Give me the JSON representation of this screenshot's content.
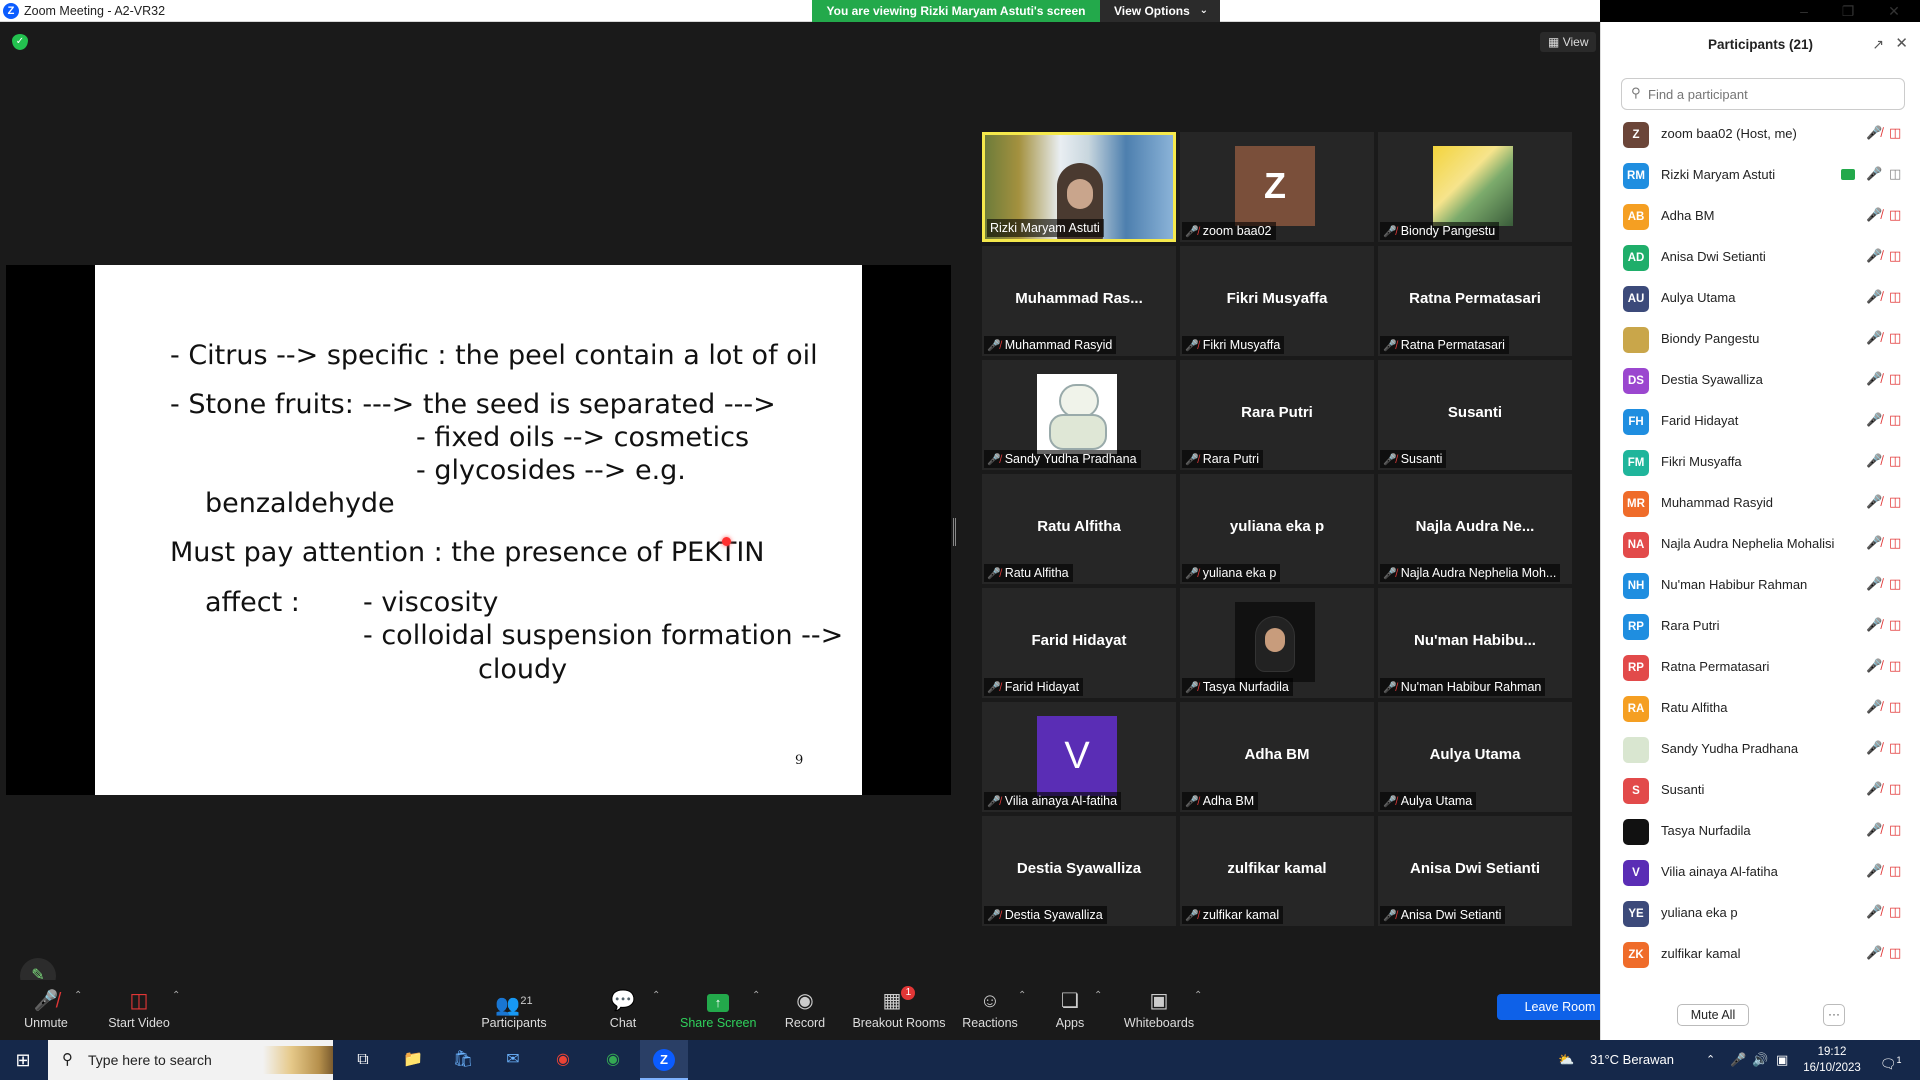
{
  "window": {
    "title": "Zoom Meeting - A2-VR32",
    "share_banner": "You are viewing Rizki Maryam Astuti's screen",
    "view_options": "View Options",
    "view_button": "View"
  },
  "slide": {
    "lines": [
      "-   Citrus --> specific : the peel contain a lot of oil",
      "-   Stone fruits: ---> the seed is separated --->",
      "- fixed oils --> cosmetics",
      "- glycosides --> e.g.",
      "benzaldehyde",
      "Must pay attention : the presence of PEKTIN",
      "affect :",
      "- viscosity",
      "- colloidal suspension formation -->",
      "cloudy"
    ],
    "page_number": "9"
  },
  "gallery": [
    {
      "center_name": "",
      "label": "Rizki Maryam Astuti",
      "muted": false,
      "avatar": "video",
      "active": true
    },
    {
      "center_name": "",
      "label": "zoom baa02",
      "muted": true,
      "avatar": "letter",
      "letter": "Z",
      "active": false
    },
    {
      "center_name": "",
      "label": "Biondy Pangestu",
      "muted": true,
      "avatar": "photo",
      "active": false
    },
    {
      "center_name": "Muhammad  Ras...",
      "label": "Muhammad Rasyid",
      "muted": true,
      "avatar": "none",
      "active": false
    },
    {
      "center_name": "Fikri Musyaffa",
      "label": "Fikri Musyaffa",
      "muted": true,
      "avatar": "none",
      "active": false
    },
    {
      "center_name": "Ratna Permatasari",
      "label": "Ratna Permatasari",
      "muted": true,
      "avatar": "none",
      "active": false
    },
    {
      "center_name": "",
      "label": "Sandy Yudha Pradhana",
      "muted": true,
      "avatar": "bear",
      "active": false
    },
    {
      "center_name": "Rara Putri",
      "label": "Rara Putri",
      "muted": true,
      "avatar": "none",
      "active": false
    },
    {
      "center_name": "Susanti",
      "label": "Susanti",
      "muted": true,
      "avatar": "none",
      "active": false
    },
    {
      "center_name": "Ratu Alfitha",
      "label": "Ratu Alfitha",
      "muted": true,
      "avatar": "none",
      "active": false
    },
    {
      "center_name": "yuliana eka p",
      "label": "yuliana eka p",
      "muted": true,
      "avatar": "none",
      "active": false
    },
    {
      "center_name": "Najla  Audra  Ne...",
      "label": "Najla Audra Nephelia Moh...",
      "muted": true,
      "avatar": "none",
      "active": false
    },
    {
      "center_name": "Farid Hidayat",
      "label": "Farid Hidayat",
      "muted": true,
      "avatar": "none",
      "active": false
    },
    {
      "center_name": "",
      "label": "Tasya Nurfadila",
      "muted": true,
      "avatar": "girl",
      "active": false
    },
    {
      "center_name": "Nu'man  Habibu...",
      "label": "Nu'man Habibur Rahman",
      "muted": true,
      "avatar": "none",
      "active": false
    },
    {
      "center_name": "",
      "label": "Vilia ainaya Al-fatiha",
      "muted": true,
      "avatar": "letter_v",
      "letter": "V",
      "active": false
    },
    {
      "center_name": "Adha BM",
      "label": "Adha BM",
      "muted": true,
      "avatar": "none",
      "active": false
    },
    {
      "center_name": "Aulya Utama",
      "label": "Aulya Utama",
      "muted": true,
      "avatar": "none",
      "active": false
    },
    {
      "center_name": "Destia Syawalliza",
      "label": "Destia Syawalliza",
      "muted": true,
      "avatar": "none",
      "active": false
    },
    {
      "center_name": "zulfikar kamal",
      "label": "zulfikar kamal",
      "muted": true,
      "avatar": "none",
      "active": false
    },
    {
      "center_name": "Anisa Dwi Setianti",
      "label": "Anisa Dwi Setianti",
      "muted": true,
      "avatar": "none",
      "active": false
    }
  ],
  "toolbar": {
    "unmute": "Unmute",
    "start_video": "Start Video",
    "participants": "Participants",
    "participants_count": "21",
    "chat": "Chat",
    "share_screen": "Share Screen",
    "record": "Record",
    "breakout_rooms": "Breakout Rooms",
    "breakout_badge": "1",
    "reactions": "Reactions",
    "apps": "Apps",
    "whiteboards": "Whiteboards",
    "leave_room": "Leave Room"
  },
  "panel": {
    "title": "Participants (21)",
    "search_placeholder": "Find a participant",
    "participants": [
      {
        "initials": "Z",
        "name": "zoom baa02 (Host, me)",
        "color": "#6b4538",
        "sharing": false
      },
      {
        "initials": "RM",
        "name": "Rizki Maryam Astuti",
        "color": "#1f8ee0",
        "sharing": true
      },
      {
        "initials": "AB",
        "name": "Adha BM",
        "color": "#f59f22",
        "sharing": false
      },
      {
        "initials": "AD",
        "name": "Anisa Dwi Setianti",
        "color": "#1fae6a",
        "sharing": false
      },
      {
        "initials": "AU",
        "name": "Aulya Utama",
        "color": "#3c4a7a",
        "sharing": false
      },
      {
        "initials": "",
        "name": "Biondy Pangestu",
        "color": "#c9a64a",
        "sharing": false
      },
      {
        "initials": "DS",
        "name": "Destia Syawalliza",
        "color": "#9b47cf",
        "sharing": false
      },
      {
        "initials": "FH",
        "name": "Farid Hidayat",
        "color": "#1f8ee0",
        "sharing": false
      },
      {
        "initials": "FM",
        "name": "Fikri Musyaffa",
        "color": "#1fb59b",
        "sharing": false
      },
      {
        "initials": "MR",
        "name": "Muhammad Rasyid",
        "color": "#ef6c2a",
        "sharing": false
      },
      {
        "initials": "NA",
        "name": "Najla Audra Nephelia Mohalisi",
        "color": "#e24a4a",
        "sharing": false
      },
      {
        "initials": "NH",
        "name": "Nu'man Habibur Rahman",
        "color": "#1f8ee0",
        "sharing": false
      },
      {
        "initials": "RP",
        "name": "Rara Putri",
        "color": "#1f8ee0",
        "sharing": false
      },
      {
        "initials": "RP",
        "name": "Ratna Permatasari",
        "color": "#e24a4a",
        "sharing": false
      },
      {
        "initials": "RA",
        "name": "Ratu Alfitha",
        "color": "#f59f22",
        "sharing": false
      },
      {
        "initials": "",
        "name": "Sandy Yudha Pradhana",
        "color": "#d9e6d0",
        "sharing": false
      },
      {
        "initials": "S",
        "name": "Susanti",
        "color": "#e24a4a",
        "sharing": false
      },
      {
        "initials": "",
        "name": "Tasya Nurfadila",
        "color": "#111111",
        "sharing": false
      },
      {
        "initials": "V",
        "name": "Vilia ainaya Al-fatiha",
        "color": "#5a2db5",
        "sharing": false
      },
      {
        "initials": "YE",
        "name": "yuliana eka p",
        "color": "#3c4a7a",
        "sharing": false
      },
      {
        "initials": "ZK",
        "name": "zulfikar kamal",
        "color": "#ef6c2a",
        "sharing": false
      }
    ],
    "mute_all": "Mute All",
    "more": "···"
  },
  "taskbar": {
    "search_placeholder": "Type here to search",
    "weather": "31°C  Berawan",
    "time": "19:12",
    "date": "16/10/2023",
    "notification_count": "1"
  },
  "colors": {
    "zoom_blue": "#0e61e8",
    "share_green": "#23a94b",
    "muted_red": "#e23636",
    "active_speaker": "#f5e94c"
  }
}
